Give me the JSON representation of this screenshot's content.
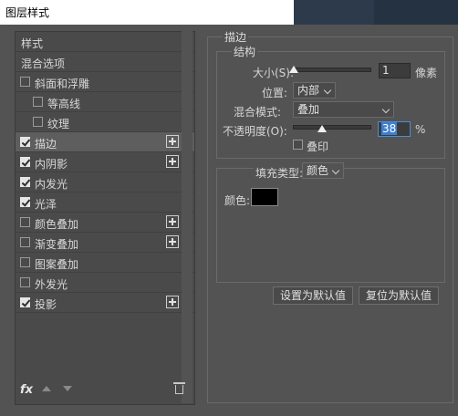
{
  "window": {
    "title": "图层样式"
  },
  "styles_list": {
    "header": "样式",
    "blend_options": "混合选项",
    "items": [
      {
        "label": "斜面和浮雕",
        "checked": false,
        "plus": false
      },
      {
        "label": "等高线",
        "checked": false,
        "plus": false
      },
      {
        "label": "纹理",
        "checked": false,
        "plus": false
      },
      {
        "label": "描边",
        "checked": true,
        "plus": true
      },
      {
        "label": "内阴影",
        "checked": true,
        "plus": true
      },
      {
        "label": "内发光",
        "checked": true,
        "plus": false
      },
      {
        "label": "光泽",
        "checked": true,
        "plus": false
      },
      {
        "label": "颜色叠加",
        "checked": false,
        "plus": true
      },
      {
        "label": "渐变叠加",
        "checked": false,
        "plus": true
      },
      {
        "label": "图案叠加",
        "checked": false,
        "plus": false
      },
      {
        "label": "外发光",
        "checked": false,
        "plus": false
      },
      {
        "label": "投影",
        "checked": true,
        "plus": true
      }
    ],
    "fx_label": "fx"
  },
  "stroke": {
    "section_title": "描边",
    "structure_title": "结构",
    "size_label": "大小(S):",
    "size_value": "1",
    "size_unit": "像素",
    "position_label": "位置:",
    "position_value": "内部",
    "blend_label": "混合模式:",
    "blend_value": "叠加",
    "opacity_label": "不透明度(O):",
    "opacity_value": "38",
    "opacity_unit": "%",
    "opacity_fraction": 0.38,
    "size_fraction": 0.01,
    "emboss_label": "叠印",
    "fill_type_label": "填充类型:",
    "fill_type_value": "颜色",
    "color_label": "颜色:",
    "color_value": "#000000"
  },
  "buttons": {
    "make_default": "设置为默认值",
    "reset_default": "复位为默认值"
  }
}
